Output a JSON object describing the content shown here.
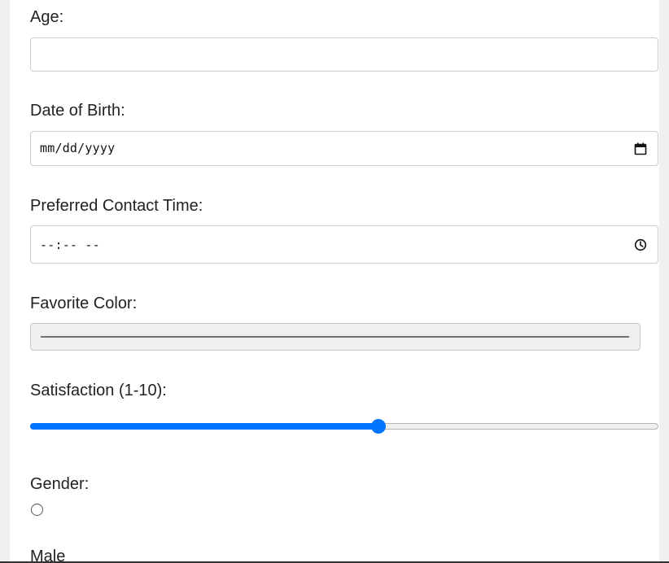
{
  "form": {
    "age": {
      "label": "Age:",
      "value": ""
    },
    "date_of_birth": {
      "label": "Date of Birth:",
      "placeholder": "mm/dd/yyyy",
      "icon": "calendar-icon"
    },
    "contact_time": {
      "label": "Preferred Contact Time:",
      "placeholder": "--:-- --",
      "icon": "clock-icon"
    },
    "favorite_color": {
      "label": "Favorite Color:",
      "value": "#707070"
    },
    "satisfaction": {
      "label": "Satisfaction (1-10):",
      "min": 1,
      "max": 10,
      "value": 6,
      "accent": "#0075ff"
    },
    "gender": {
      "label": "Gender:",
      "options": [
        {
          "label": "Male",
          "checked": false
        }
      ]
    }
  }
}
